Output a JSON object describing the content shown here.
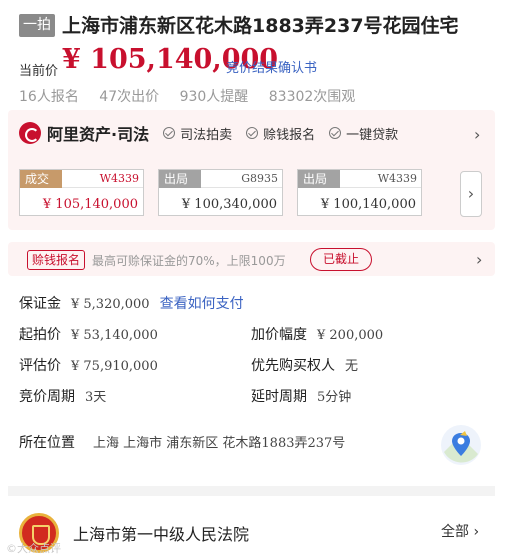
{
  "header": {
    "round_badge": "一拍",
    "title": "上海市浦东新区花木路1883弄237号花园住宅"
  },
  "price": {
    "label": "当前价",
    "value": "¥ 105,140,000",
    "result_link": "竞价结果确认书"
  },
  "stats": {
    "signups": "16人报名",
    "bids": "47次出价",
    "reminders": "930人提醒",
    "views": "83302次围观"
  },
  "brand": {
    "name": "阿里资产·司法",
    "features": [
      "司法拍卖",
      "赊钱报名",
      "一键贷款"
    ]
  },
  "bid_history": [
    {
      "status": "成交",
      "code": "W4339",
      "amount": "¥ 105,140,000",
      "result": "won"
    },
    {
      "status": "出局",
      "code": "G8935",
      "amount": "¥ 100,340,000",
      "result": "lost"
    },
    {
      "status": "出局",
      "code": "W4339",
      "amount": "¥ 100,140,000",
      "result": "lost"
    }
  ],
  "credit": {
    "tag": "赊钱报名",
    "text": "最高可赊保证金的70%，上限100万",
    "button": "已截止"
  },
  "details": {
    "deposit_label": "保证金",
    "deposit_value": "¥ 5,320,000",
    "deposit_link": "查看如何支付",
    "start_price_label": "起拍价",
    "start_price_value": "¥ 53,140,000",
    "increment_label": "加价幅度",
    "increment_value": "¥ 200,000",
    "appraisal_label": "评估价",
    "appraisal_value": "¥ 75,910,000",
    "priority_label": "优先购买权人",
    "priority_value": "无",
    "period_label": "竞价周期",
    "period_value": "3天",
    "extension_label": "延时周期",
    "extension_value": "5分钟",
    "location_label": "所在位置",
    "location_value": "上海 上海市 浦东新区 花木路1883弄237号"
  },
  "court": {
    "name": "上海市第一中级人民法院",
    "all_link": "全部"
  },
  "watermark": "©大众点评",
  "colors": {
    "accent_red": "#c8102e",
    "link_blue": "#3b63c2",
    "muted_gray": "#999999"
  },
  "icons": [
    "brand-logo-icon",
    "check-circle-icon",
    "chevron-right-icon",
    "map-pin-icon",
    "court-emblem-icon"
  ]
}
